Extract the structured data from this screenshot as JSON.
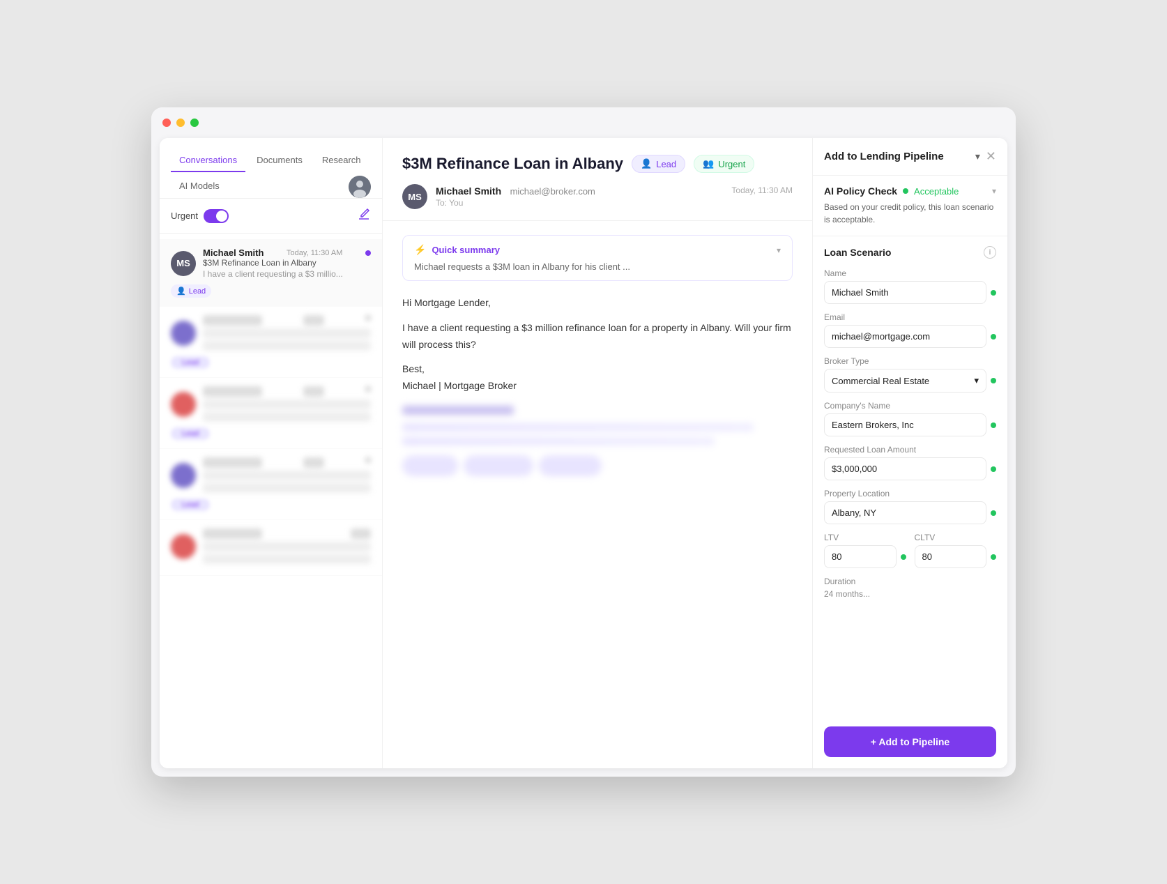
{
  "window": {
    "dots": [
      "red",
      "yellow",
      "green"
    ]
  },
  "sidebar": {
    "tabs": [
      {
        "label": "Conversations",
        "active": true
      },
      {
        "label": "Documents",
        "active": false
      },
      {
        "label": "Research",
        "active": false
      },
      {
        "label": "AI Models",
        "active": false
      }
    ],
    "urgent_label": "Urgent",
    "compose_icon": "✏",
    "conversations": [
      {
        "id": "ms",
        "name": "Michael Smith",
        "time": "Today, 11:30 AM",
        "subject": "$3M Refinance Loan in Albany",
        "preview": "I have a client requesting a $3 millio...",
        "badge": "Lead",
        "active": true,
        "unread": true,
        "avatar_initials": "MS",
        "avatar_class": "conv-avatar-ms"
      },
      {
        "id": "blur1",
        "blurred": true,
        "badge_blurred": true
      },
      {
        "id": "blur2",
        "blurred": true,
        "badge_blurred": true
      },
      {
        "id": "blur3",
        "blurred": true,
        "badge_blurred": true
      },
      {
        "id": "blur4",
        "blurred": true,
        "badge_blurred": true
      }
    ]
  },
  "email": {
    "title": "$3M Refinance Loan in Albany",
    "tags": [
      {
        "label": "Lead",
        "type": "lead",
        "icon": "👤"
      },
      {
        "label": "Urgent",
        "type": "urgent",
        "icon": "👥"
      }
    ],
    "sender": {
      "name": "Michael Smith",
      "email": "michael@broker.com",
      "to": "To: You",
      "timestamp": "Today, 11:30 AM",
      "initials": "MS"
    },
    "quick_summary": {
      "title": "Quick summary",
      "text": "Michael requests a $3M loan in Albany for his client ..."
    },
    "body_lines": [
      "Hi Mortgage Lender,",
      "I have a client requesting a $3 million refinance loan for a property in Albany. Will your firm will process this?",
      "Best,",
      "Michael | Mortgage Broker"
    ]
  },
  "panel": {
    "title": "Add to Lending Pipeline",
    "dropdown_icon": "▾",
    "close_icon": "✕",
    "policy_check": {
      "title": "AI Policy Check",
      "status": "Acceptable",
      "text": "Based on your credit policy, this loan scenario is acceptable."
    },
    "loan_scenario": {
      "title": "Loan Scenario",
      "fields": [
        {
          "label": "Name",
          "value": "Michael Smith",
          "type": "text"
        },
        {
          "label": "Email",
          "value": "michael@mortgage.com",
          "type": "text"
        },
        {
          "label": "Broker Type",
          "value": "Commercial Real Estate",
          "type": "select"
        },
        {
          "label": "Company's Name",
          "value": "Eastern Brokers, Inc",
          "type": "text"
        },
        {
          "label": "Requested Loan Amount",
          "value": "$3,000,000",
          "type": "text"
        },
        {
          "label": "Property Location",
          "value": "Albany, NY",
          "type": "text"
        }
      ],
      "ltv": {
        "label": "LTV",
        "value": "80"
      },
      "cltv": {
        "label": "CLTV",
        "value": "80"
      },
      "duration": {
        "label": "Duration",
        "value": ""
      }
    },
    "add_button": "+ Add to Pipeline"
  }
}
